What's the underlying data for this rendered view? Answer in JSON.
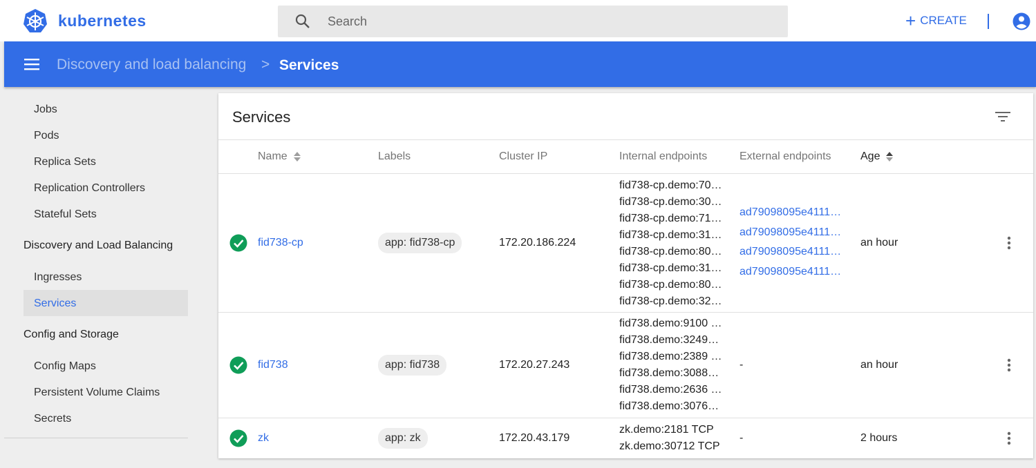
{
  "app": {
    "brand": "kubernetes"
  },
  "search": {
    "placeholder": "Search"
  },
  "topbar": {
    "create_label": "CREATE",
    "create_icon": "plus-icon",
    "account_icon": "account-circle-icon"
  },
  "breadcrumb": {
    "parent": "Discovery and load balancing",
    "separator": ">",
    "current": "Services"
  },
  "sidebar": {
    "items_workloads": [
      "Jobs",
      "Pods",
      "Replica Sets",
      "Replication Controllers",
      "Stateful Sets"
    ],
    "section_discovery": "Discovery and Load Balancing",
    "items_discovery": [
      "Ingresses",
      "Services"
    ],
    "active_item": "Services",
    "section_config": "Config and Storage",
    "items_config": [
      "Config Maps",
      "Persistent Volume Claims",
      "Secrets"
    ]
  },
  "card": {
    "title": "Services",
    "columns": [
      "Name",
      "Labels",
      "Cluster IP",
      "Internal endpoints",
      "External endpoints",
      "Age"
    ],
    "rows": [
      {
        "status": "ok",
        "name": "fid738-cp",
        "label": "app: fid738-cp",
        "cluster_ip": "172.20.186.224",
        "internal": [
          "fid738-cp.demo:70…",
          "fid738-cp.demo:30…",
          "fid738-cp.demo:71…",
          "fid738-cp.demo:31…",
          "fid738-cp.demo:80…",
          "fid738-cp.demo:31…",
          "fid738-cp.demo:80…",
          "fid738-cp.demo:32…"
        ],
        "external": [
          "ad79098095e4111…",
          "ad79098095e4111…",
          "ad79098095e4111…",
          "ad79098095e4111…"
        ],
        "age": "an hour"
      },
      {
        "status": "ok",
        "name": "fid738",
        "label": "app: fid738",
        "cluster_ip": "172.20.27.243",
        "internal": [
          "fid738.demo:9100 …",
          "fid738.demo:3249…",
          "fid738.demo:2389 …",
          "fid738.demo:3088…",
          "fid738.demo:2636 …",
          "fid738.demo:3076…"
        ],
        "external_text": "-",
        "age": "an hour"
      },
      {
        "status": "ok",
        "name": "zk",
        "label": "app: zk",
        "cluster_ip": "172.20.43.179",
        "internal": [
          "zk.demo:2181 TCP",
          "zk.demo:30712 TCP"
        ],
        "external_text": "-",
        "age": "2 hours"
      }
    ]
  },
  "colors": {
    "brand_blue": "#326de6",
    "success_green": "#0f9d58",
    "header_text_muted": "#a7c1f2"
  }
}
